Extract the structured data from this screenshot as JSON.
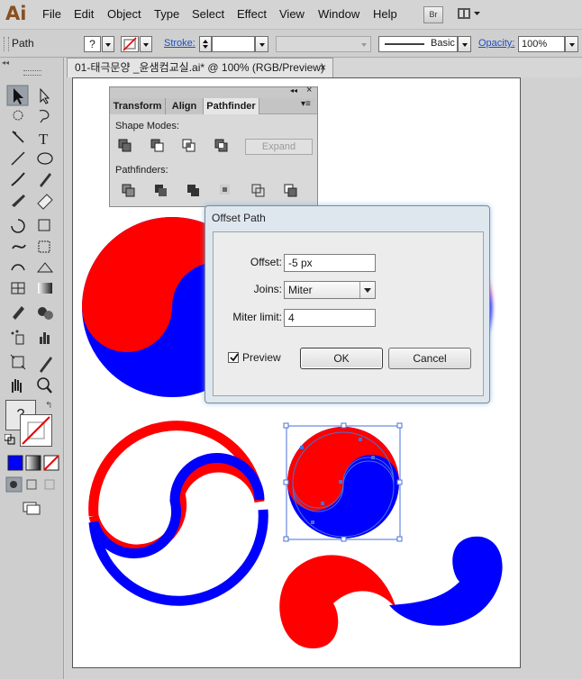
{
  "app": {
    "logo": "Ai",
    "bridge_label": "Br"
  },
  "menu": [
    "File",
    "Edit",
    "Object",
    "Type",
    "Select",
    "Effect",
    "View",
    "Window",
    "Help"
  ],
  "controlbar": {
    "selection_type": "Path",
    "fill_label": "?",
    "stroke_label": "Stroke:",
    "brush_style": "Basic",
    "opacity_label": "Opacity:",
    "opacity_value": "100%"
  },
  "document": {
    "tab_title": "01-태극문양 _윤샘컴교실.ai* @ 100% (RGB/Preview)",
    "close_glyph": "×"
  },
  "pathfinder": {
    "tabs": [
      "Transform",
      "Align",
      "Pathfinder"
    ],
    "active_tab": "Pathfinder",
    "shape_modes_label": "Shape Modes:",
    "expand_label": "Expand",
    "pathfinders_label": "Pathfinders:"
  },
  "dialog": {
    "title": "Offset Path",
    "offset_label": "Offset:",
    "offset_value": "-5 px",
    "joins_label": "Joins:",
    "joins_value": "Miter",
    "miter_label": "Miter limit:",
    "miter_value": "4",
    "preview_label": "Preview",
    "preview_checked": true,
    "ok_label": "OK",
    "cancel_label": "Cancel"
  },
  "tools": {
    "fill_label": "?",
    "icons": [
      "selection-tool",
      "direct-selection-tool",
      "magic-wand-tool",
      "lasso-tool",
      "pen-tool",
      "type-tool",
      "line-tool",
      "ellipse-tool",
      "paintbrush-tool",
      "pencil-tool",
      "blob-brush-tool",
      "eraser-tool",
      "rotate-tool",
      "scale-tool",
      "warp-tool",
      "free-transform-tool",
      "shape-builder-tool",
      "perspective-grid-tool",
      "mesh-tool",
      "gradient-tool",
      "eyedropper-tool",
      "blend-tool",
      "symbol-sprayer-tool",
      "column-graph-tool",
      "artboard-tool",
      "slice-tool",
      "hand-tool",
      "zoom-tool"
    ]
  },
  "colors": {
    "red": "#ff0000",
    "blue": "#0000ff",
    "selection": "#4a6fd8"
  }
}
